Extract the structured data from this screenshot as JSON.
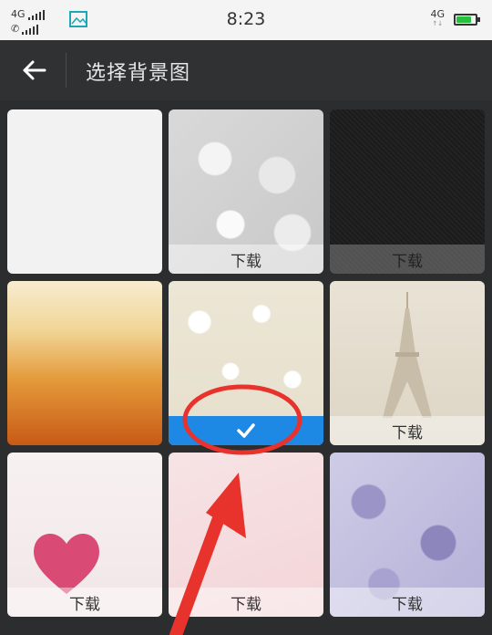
{
  "statusbar": {
    "network1": "4G",
    "time": "8:23",
    "network_right": "4G",
    "battery_level": 0.8
  },
  "appbar": {
    "title": "选择背景图"
  },
  "grid": {
    "download_label": "下载",
    "tiles": [
      {
        "name": "white",
        "state": "none"
      },
      {
        "name": "silver-bokeh",
        "state": "download"
      },
      {
        "name": "dark-carbon",
        "state": "download"
      },
      {
        "name": "golden-glitter",
        "state": "none"
      },
      {
        "name": "cream-confetti",
        "state": "selected"
      },
      {
        "name": "eiffel-tower",
        "state": "download"
      },
      {
        "name": "pink-heart",
        "state": "download"
      },
      {
        "name": "pink-paper",
        "state": "download"
      },
      {
        "name": "purple-raindrops",
        "state": "download"
      }
    ]
  },
  "colors": {
    "selected_bar": "#1e88e5",
    "annotation": "#e8322c"
  }
}
